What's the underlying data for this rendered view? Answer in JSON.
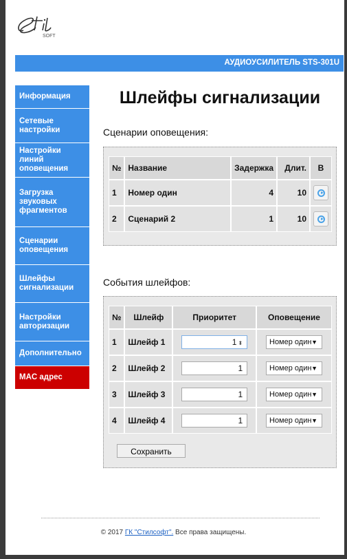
{
  "logo": {
    "text": "Stil",
    "sub": "SOFT"
  },
  "header": {
    "device_title": "АУДИОУСИЛИТЕЛЬ STS-301U"
  },
  "sidebar": {
    "items": [
      {
        "label": "Информация"
      },
      {
        "label": "Сетевые настройки"
      },
      {
        "label": "Настройки линий оповещения"
      },
      {
        "label": "Загрузка звуковых фрагментов"
      },
      {
        "label": "Сценарии оповещения"
      },
      {
        "label": "Шлейфы сигнализации"
      },
      {
        "label": "Настройки авторизации"
      },
      {
        "label": "Дополнительно"
      },
      {
        "label": "MAC адрес"
      }
    ]
  },
  "page": {
    "title": "Шлейфы сигнализации"
  },
  "scenarios": {
    "section_title": "Сценарии оповещения:",
    "headers": {
      "num": "№",
      "name": "Название",
      "delay": "Задержка",
      "dur": "Длит.",
      "b": "В"
    },
    "rows": [
      {
        "num": "1",
        "name": "Номер один",
        "delay": "4",
        "dur": "10"
      },
      {
        "num": "2",
        "name": "Сценарий 2",
        "delay": "1",
        "dur": "10"
      }
    ]
  },
  "loops": {
    "section_title": "События шлейфов:",
    "headers": {
      "num": "№",
      "loop": "Шлейф",
      "priority": "Приоритет",
      "alert": "Оповещение"
    },
    "rows": [
      {
        "num": "1",
        "name": "Шлейф 1",
        "priority": "1",
        "alert": "Номер один"
      },
      {
        "num": "2",
        "name": "Шлейф 2",
        "priority": "1",
        "alert": "Номер один"
      },
      {
        "num": "3",
        "name": "Шлейф 3",
        "priority": "1",
        "alert": "Номер один"
      },
      {
        "num": "4",
        "name": "Шлейф 4",
        "priority": "1",
        "alert": "Номер один"
      }
    ],
    "save_label": "Сохранить"
  },
  "footer": {
    "prefix": "© 2017 ",
    "link": "ГК \"Стилсофт\".",
    "suffix": " Все права защищены."
  }
}
